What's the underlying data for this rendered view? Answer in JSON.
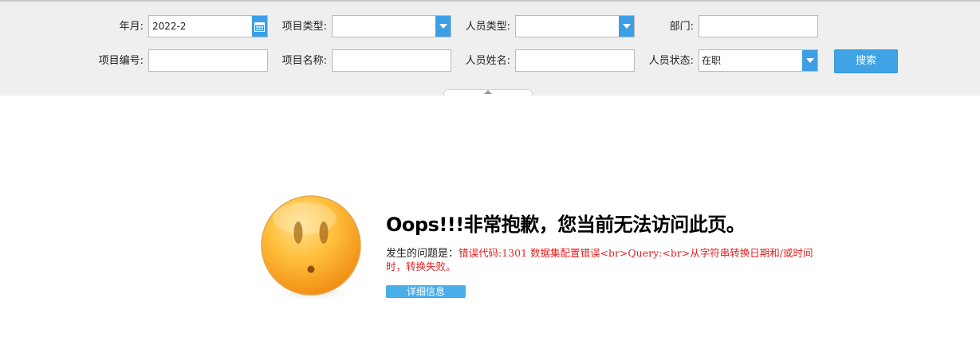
{
  "filters": {
    "year_month": {
      "label": "年月:",
      "value": "2022-2"
    },
    "project_type": {
      "label": "项目类型:",
      "value": ""
    },
    "staff_type": {
      "label": "人员类型:",
      "value": ""
    },
    "department": {
      "label": "部门:",
      "value": ""
    },
    "project_code": {
      "label": "项目编号:",
      "value": ""
    },
    "project_name": {
      "label": "项目名称:",
      "value": ""
    },
    "staff_name": {
      "label": "人员姓名:",
      "value": ""
    },
    "staff_status": {
      "label": "人员状态:",
      "value": "在职"
    },
    "search_label": "搜索"
  },
  "error": {
    "title": "Oops!!!非常抱歉，您当前无法访问此页。",
    "prefix": "发生的问题是：",
    "message": "错误代码:1301 数据集配置错误<br>Query:<br>从字符串转换日期和/或时间时，转换失败。",
    "detail_label": "详细信息"
  },
  "icons": {
    "calendar": "calendar-icon",
    "dropdown": "chevron-down-icon",
    "face": "sad-face-icon"
  },
  "colors": {
    "accent": "#3a9fe4",
    "error_text": "#e41e1e"
  }
}
